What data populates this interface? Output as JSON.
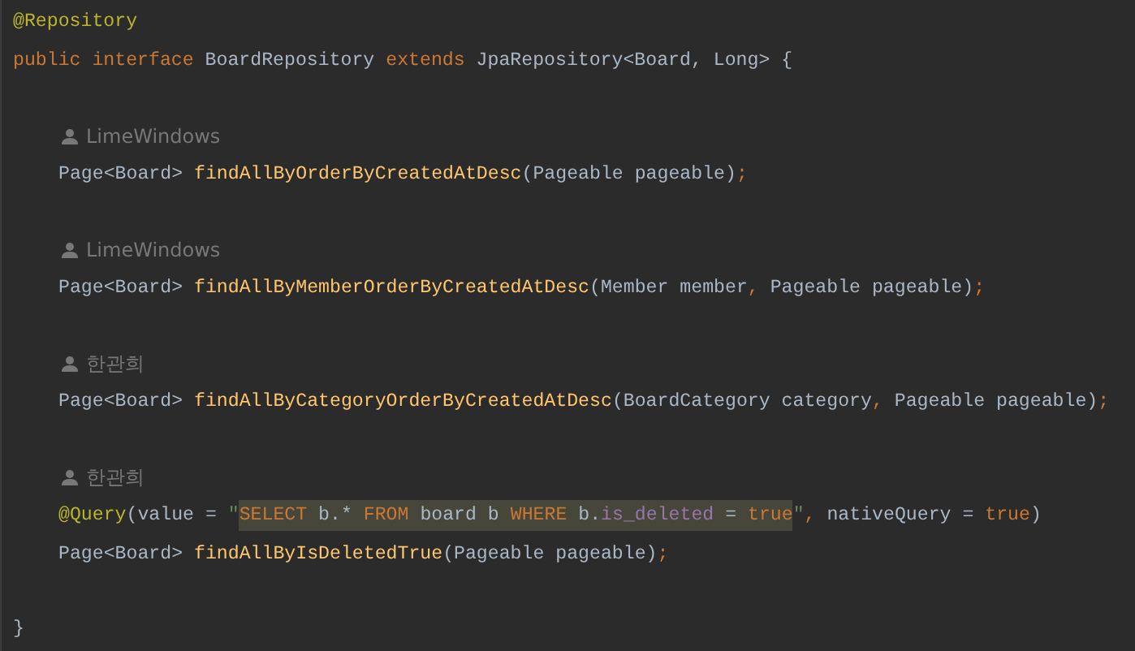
{
  "editor": {
    "lines": [
      {
        "kind": "code",
        "tokens": [
          {
            "kind": "annotation",
            "text": "@Repository"
          }
        ]
      },
      {
        "kind": "code",
        "tokens": [
          {
            "kind": "keyword",
            "text": "public interface "
          },
          {
            "kind": "plain",
            "text": "BoardRepository "
          },
          {
            "kind": "keyword",
            "text": "extends "
          },
          {
            "kind": "plain",
            "text": "JpaRepository<Board, Long> {"
          }
        ]
      },
      {
        "kind": "blank"
      },
      {
        "kind": "author",
        "text": "LimeWindows"
      },
      {
        "kind": "member",
        "tokens": [
          {
            "kind": "plain",
            "text": "Page<Board> "
          },
          {
            "kind": "method",
            "text": "findAllByOrderByCreatedAtDesc"
          },
          {
            "kind": "plain",
            "text": "(Pageable pageable)"
          },
          {
            "kind": "keyword",
            "text": ";"
          }
        ]
      },
      {
        "kind": "blank"
      },
      {
        "kind": "author",
        "text": "LimeWindows"
      },
      {
        "kind": "member",
        "tokens": [
          {
            "kind": "plain",
            "text": "Page<Board> "
          },
          {
            "kind": "method",
            "text": "findAllByMemberOrderByCreatedAtDesc"
          },
          {
            "kind": "plain",
            "text": "(Member member"
          },
          {
            "kind": "keyword",
            "text": ", "
          },
          {
            "kind": "plain",
            "text": "Pageable pageable)"
          },
          {
            "kind": "keyword",
            "text": ";"
          }
        ]
      },
      {
        "kind": "blank"
      },
      {
        "kind": "author",
        "text": "한관희"
      },
      {
        "kind": "member",
        "tokens": [
          {
            "kind": "plain",
            "text": "Page<Board> "
          },
          {
            "kind": "method",
            "text": "findAllByCategoryOrderByCreatedAtDesc"
          },
          {
            "kind": "plain",
            "text": "(BoardCategory category"
          },
          {
            "kind": "keyword",
            "text": ", "
          },
          {
            "kind": "plain",
            "text": "Pageable pageable)"
          },
          {
            "kind": "keyword",
            "text": ";"
          }
        ]
      },
      {
        "kind": "blank"
      },
      {
        "kind": "author",
        "text": "한관희"
      },
      {
        "kind": "member",
        "tokens": [
          {
            "kind": "annotation",
            "text": "@Query"
          },
          {
            "kind": "plain",
            "text": "(value = "
          },
          {
            "kind": "string",
            "text": "\""
          },
          {
            "kind": "injected",
            "tokens": [
              {
                "kind": "keyword",
                "text": "SELECT "
              },
              {
                "kind": "plain",
                "text": "b.* "
              },
              {
                "kind": "keyword",
                "text": "FROM "
              },
              {
                "kind": "plain",
                "text": "board b "
              },
              {
                "kind": "keyword",
                "text": "WHERE "
              },
              {
                "kind": "plain",
                "text": "b."
              },
              {
                "kind": "field",
                "text": "is_deleted"
              },
              {
                "kind": "plain",
                "text": " = "
              },
              {
                "kind": "keyword",
                "text": "true"
              }
            ]
          },
          {
            "kind": "string",
            "text": "\""
          },
          {
            "kind": "keyword",
            "text": ", "
          },
          {
            "kind": "plain",
            "text": "nativeQuery = "
          },
          {
            "kind": "keyword",
            "text": "true"
          },
          {
            "kind": "plain",
            "text": ")"
          }
        ]
      },
      {
        "kind": "member",
        "tokens": [
          {
            "kind": "plain",
            "text": "Page<Board> "
          },
          {
            "kind": "method",
            "text": "findAllByIsDeletedTrue"
          },
          {
            "kind": "plain",
            "text": "(Pageable pageable)"
          },
          {
            "kind": "keyword",
            "text": ";"
          }
        ]
      },
      {
        "kind": "blank"
      },
      {
        "kind": "code",
        "tokens": [
          {
            "kind": "plain",
            "text": "}"
          }
        ]
      }
    ]
  }
}
